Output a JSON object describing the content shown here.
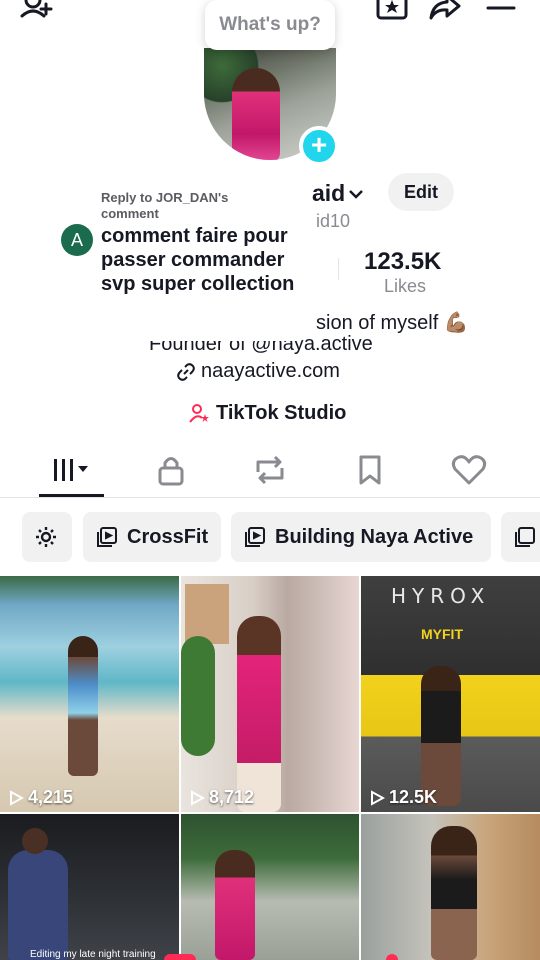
{
  "top_bar": {
    "add_friend_icon": "add-person-icon",
    "favorites_icon": "star-bookmark-icon",
    "share_icon": "share-arrow-icon",
    "menu_icon": "hamburger-menu-icon"
  },
  "status_bubble": {
    "text": "What's up?"
  },
  "profile": {
    "username_fragment": "aid",
    "handle_fragment": "id10",
    "edit_label": "Edit",
    "likes_value": "123.5K",
    "likes_label": "Likes",
    "bio_line1": "sion of myself 💪🏽",
    "bio_line2": "Founder of @naya.active",
    "link_text": "naayactive.com",
    "studio_label": "TikTok Studio"
  },
  "comment_popup": {
    "reply_to": "Reply to JOR_DAN's comment",
    "avatar_letter": "A",
    "body": "comment faire pour passer commander svp super collection"
  },
  "tabs": [
    {
      "name": "videos",
      "icon": "grid-icon",
      "active": true
    },
    {
      "name": "private",
      "icon": "lock-icon"
    },
    {
      "name": "reposts",
      "icon": "repost-icon"
    },
    {
      "name": "favorites",
      "icon": "bookmark-icon"
    },
    {
      "name": "liked",
      "icon": "heart-icon"
    }
  ],
  "collections": [
    {
      "label": ""
    },
    {
      "label": "CrossFit"
    },
    {
      "label": "Building Naya Active"
    },
    {
      "label": ""
    }
  ],
  "videos": [
    {
      "views": "4,215"
    },
    {
      "views": "8,712"
    },
    {
      "views": "12.5K"
    },
    {
      "views": "",
      "caption": "Editing my late night training"
    },
    {
      "views": ""
    },
    {
      "views": ""
    }
  ],
  "colors": {
    "accent": "#20d5ec",
    "brand_pink": "#fe2c55",
    "text": "#161823",
    "muted": "#8a8b91"
  }
}
